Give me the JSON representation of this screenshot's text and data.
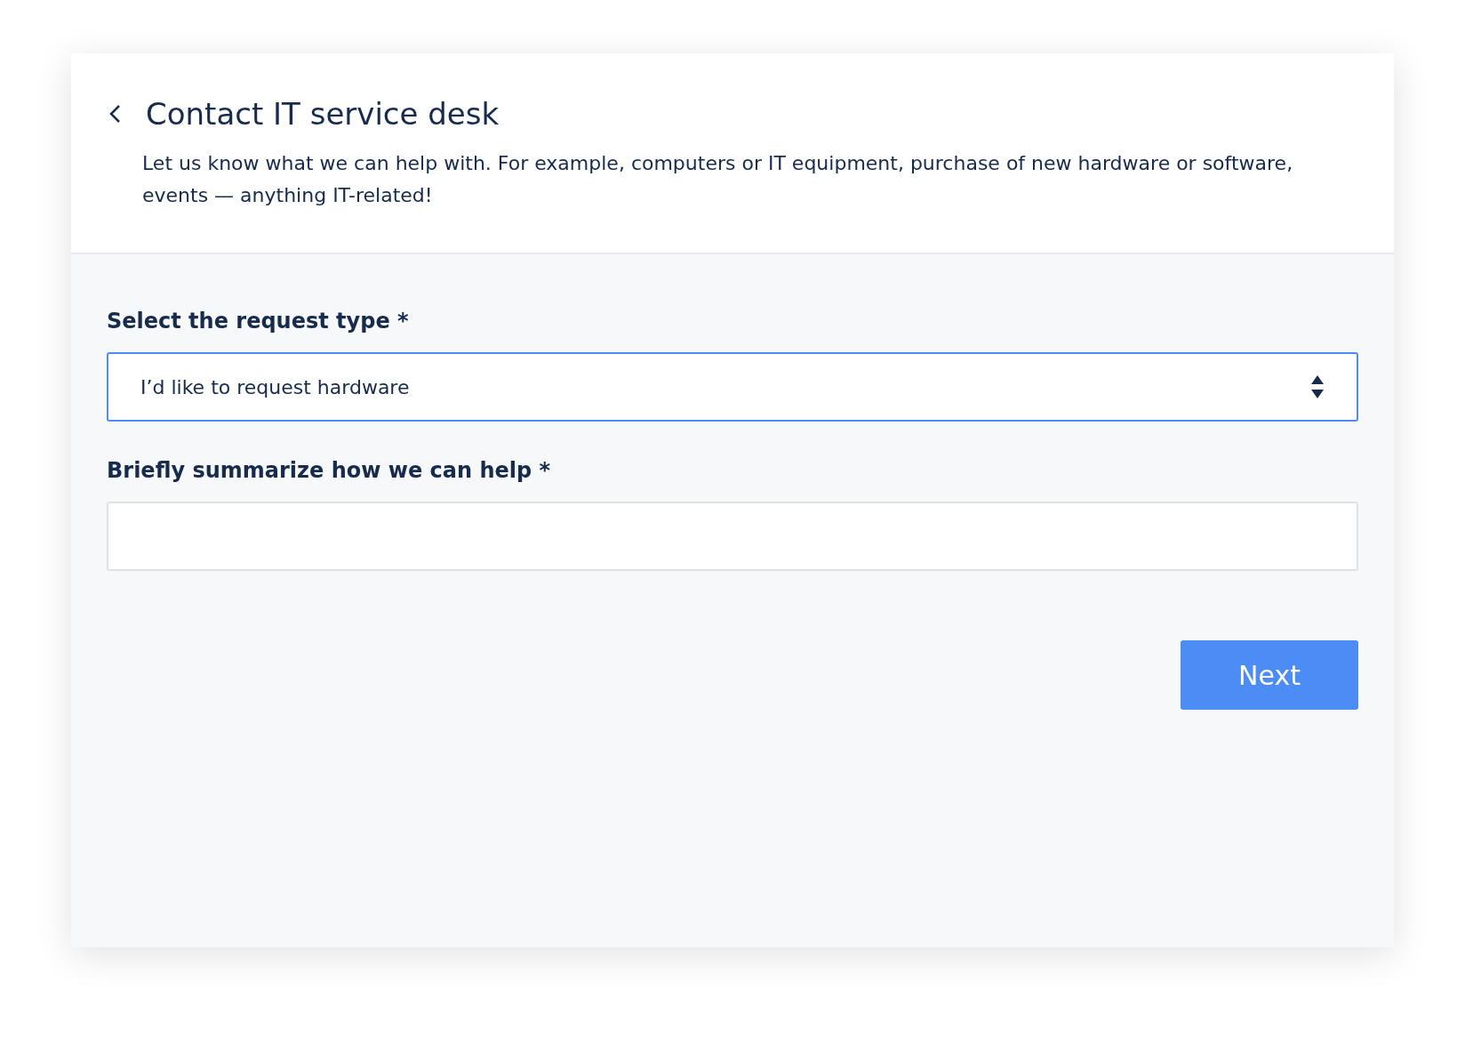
{
  "header": {
    "title": "Contact IT service desk",
    "description": "Let us know what we can help with. For example, computers or IT equipment, purchase of new hardware or software, events — anything IT-related!"
  },
  "fields": [
    {
      "kind": "select",
      "label": "Select the request type *",
      "value": "I’d like to request hardware",
      "focused": true
    },
    {
      "kind": "text",
      "label": "Briefly summarize how we can help *",
      "focused": false
    }
  ],
  "button": {
    "label": "Next"
  }
}
